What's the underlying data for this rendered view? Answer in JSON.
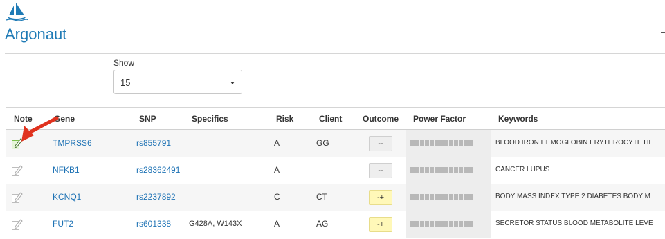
{
  "app": {
    "brand": "Argonaut",
    "logo_icon": "sailboat-icon",
    "brand_color": "#1f7bb6"
  },
  "filter": {
    "show_label": "Show",
    "show_value": "15"
  },
  "table": {
    "headers": {
      "note": "Note",
      "gene": "Gene",
      "snp": "SNP",
      "specifics": "Specifics",
      "risk": "Risk",
      "client": "Client",
      "outcome": "Outcome",
      "power_factor": "Power Factor",
      "keywords": "Keywords"
    },
    "rows": [
      {
        "note_active": true,
        "gene": "TMPRSS6",
        "snp": "rs855791",
        "specifics": "",
        "risk": "A",
        "client": "GG",
        "outcome": "--",
        "keywords": "BLOOD IRON HEMOGLOBIN ERYTHROCYTE HE"
      },
      {
        "note_active": false,
        "gene": "NFKB1",
        "snp": "rs28362491",
        "specifics": "",
        "risk": "A",
        "client": "",
        "outcome": "--",
        "keywords": "CANCER LUPUS"
      },
      {
        "note_active": false,
        "gene": "KCNQ1",
        "snp": "rs2237892",
        "specifics": "",
        "risk": "C",
        "client": "CT",
        "outcome": "-+",
        "keywords": "BODY MASS INDEX TYPE 2 DIABETES BODY M"
      },
      {
        "note_active": false,
        "gene": "FUT2",
        "snp": "rs601338",
        "specifics": "G428A, W143X",
        "risk": "A",
        "client": "AG",
        "outcome": "-+",
        "keywords": "SECRETOR STATUS BLOOD METABOLITE LEVE"
      }
    ]
  },
  "colors": {
    "link": "#1f73b5",
    "outcome_neutral": "#eeeeee",
    "outcome_positive": "#fff8b8",
    "annotation_arrow": "#e0321e",
    "note_active": "#7cc04b"
  }
}
